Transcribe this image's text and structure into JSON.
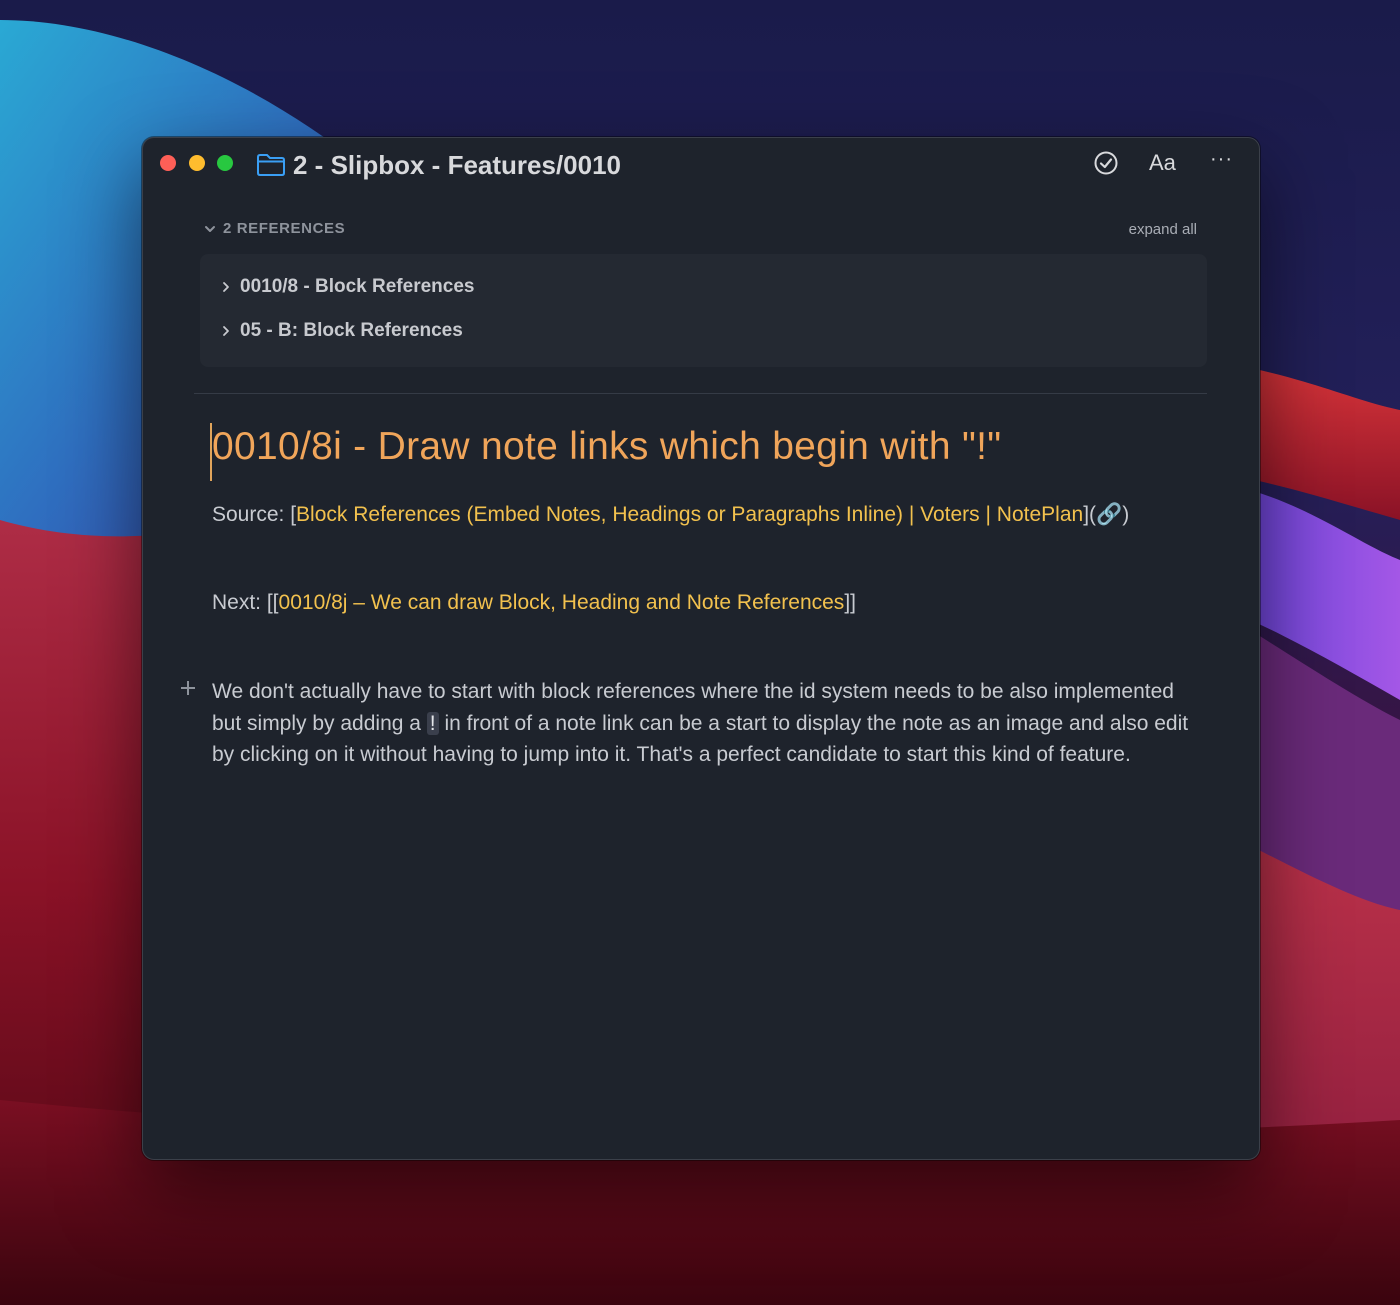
{
  "window": {
    "title": "2 - Slipbox - Features/0010",
    "folder_icon": "folder-icon"
  },
  "toolbar": {
    "check_icon": "check-circle-icon",
    "font_label": "Aa",
    "more_label": "···"
  },
  "references": {
    "header": "2 REFERENCES",
    "expand_all": "expand all",
    "items": [
      {
        "label": "0010/8 - Block References"
      },
      {
        "label": "05 - B: Block References"
      }
    ]
  },
  "note": {
    "title": "0010/8i - Draw note links which begin with \"!\"",
    "source": {
      "prefix": "Source: [",
      "link": "Block References (Embed Notes, Headings or Paragraphs Inline) | Voters | NotePlan",
      "suffix": "](",
      "link_icon": "🔗",
      "end": ")"
    },
    "next": {
      "prefix": "Next: [[",
      "link": "0010/8j – We can draw Block, Heading and Note References",
      "suffix": "]]"
    },
    "paragraph": {
      "before": "We don't actually have to start with block references where the id system needs to be also implemented but simply by adding a ",
      "code": "!",
      "after": " in front of a note link can be a start to display the note as an image and also edit by clicking on it without having to jump into it. That's a perfect candidate to start this kind of feature."
    }
  },
  "colors": {
    "title": "#f0a55a",
    "link": "#f2c14e",
    "window_bg": "#1e232c",
    "close": "#fe5f57",
    "minimize": "#febc2e",
    "zoom": "#28c840",
    "folder": "#3a9ff5"
  }
}
